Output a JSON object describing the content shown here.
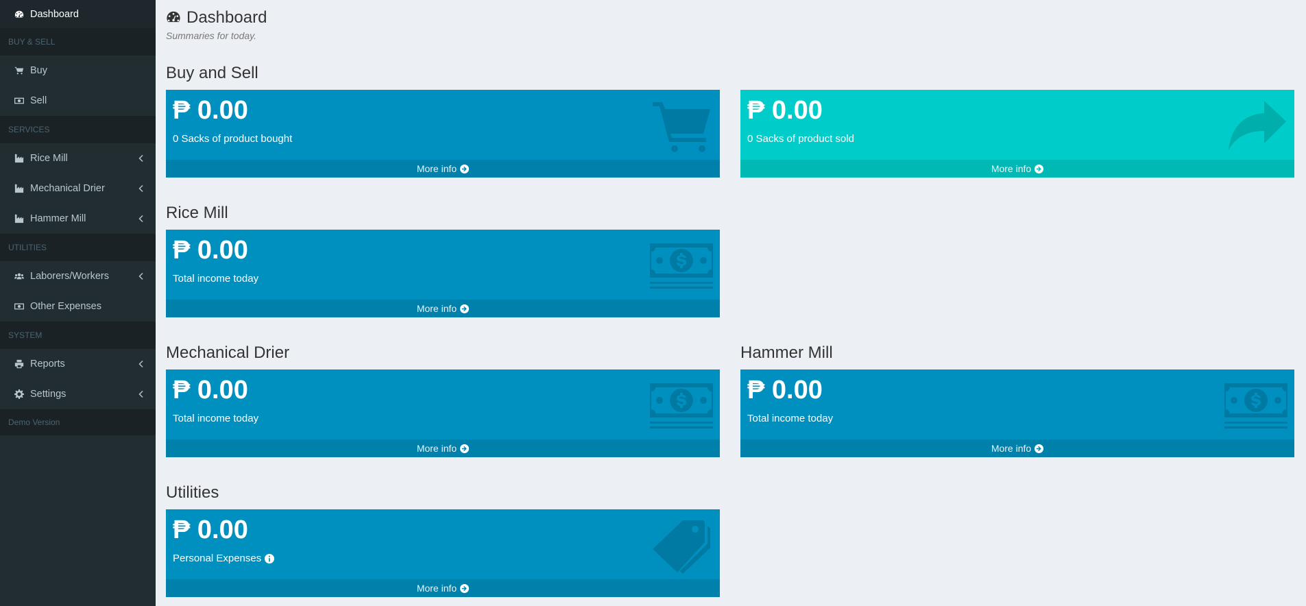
{
  "sidebar": {
    "dashboard": "Dashboard",
    "header_buysell": "BUY & SELL",
    "buy": "Buy",
    "sell": "Sell",
    "header_services": "SERVICES",
    "rice_mill": "Rice Mill",
    "mechanical_drier": "Mechanical Drier",
    "hammer_mill": "Hammer Mill",
    "header_utilities": "UTILITIES",
    "laborers": "Laborers/Workers",
    "other_expenses": "Other Expenses",
    "header_system": "SYSTEM",
    "reports": "Reports",
    "settings": "Settings",
    "footer": "Demo Version"
  },
  "header": {
    "title": "Dashboard",
    "subtitle": "Summaries for today."
  },
  "sections": {
    "buy_sell": "Buy and Sell",
    "rice_mill": "Rice Mill",
    "mechanical_drier": "Mechanical Drier",
    "hammer_mill": "Hammer Mill",
    "utilities": "Utilities"
  },
  "boxes": {
    "bought": {
      "amount": "₱ 0.00",
      "desc": "0 Sacks of product bought",
      "more": "More info",
      "icon": "shopping-cart-icon"
    },
    "sold": {
      "amount": "₱ 0.00",
      "desc": "0 Sacks of product sold",
      "more": "More info",
      "icon": "share-arrow-icon"
    },
    "rice_mill": {
      "amount": "₱ 0.00",
      "desc": "Total income today",
      "more": "More info",
      "icon": "money-bill-icon"
    },
    "mechanical_drier": {
      "amount": "₱ 0.00",
      "desc": "Total income today",
      "more": "More info",
      "icon": "money-bill-icon"
    },
    "hammer_mill": {
      "amount": "₱ 0.00",
      "desc": "Total income today",
      "more": "More info",
      "icon": "money-bill-icon"
    },
    "utilities": {
      "amount": "₱ 0.00",
      "desc": "Personal Expenses",
      "more": "More info",
      "icon": "tag-icon"
    }
  },
  "colors": {
    "sidebar_bg": "#222d32",
    "content_bg": "#ecf0f5",
    "box_blue": "#0090bf",
    "box_teal": "#00cdc9"
  }
}
